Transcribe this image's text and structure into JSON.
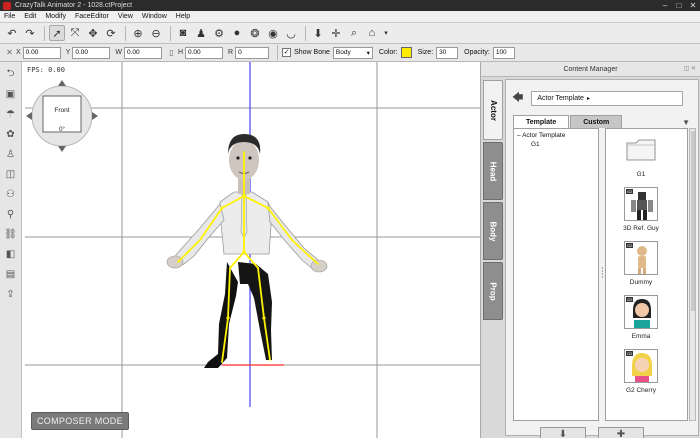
{
  "window": {
    "title": "CrazyTalk Animator 2  -  1028.ctProject"
  },
  "menu": [
    "File",
    "Edit",
    "Modify",
    "FaceEditor",
    "View",
    "Window",
    "Help"
  ],
  "transform": {
    "x_label": "X",
    "x_value": "0.00",
    "y_label": "Y",
    "y_value": "0.00",
    "w_label": "W",
    "w_value": "0.00",
    "h_label": "H",
    "h_value": "0.00",
    "r_label": "R",
    "r_value": "0"
  },
  "bone": {
    "show_bone_label": "Show Bone",
    "show_bone_checked": true,
    "target": "Body",
    "color_label": "Color:",
    "color_value": "#ffeb00",
    "size_label": "Size:",
    "size_value": "30",
    "opacity_label": "Opacity:",
    "opacity_value": "100"
  },
  "viewport": {
    "fps": "FPS: 0.00",
    "camera_view": "Front",
    "camera_angle": "0°",
    "mode_badge": "COMPOSER MODE"
  },
  "content_manager": {
    "title": "Content Manager",
    "side_tabs": [
      "Actor",
      "Head",
      "Body",
      "Prop"
    ],
    "breadcrumb": "Actor Template",
    "tabs": [
      "Template",
      "Custom"
    ],
    "tree": [
      "Actor Template",
      "G1"
    ],
    "thumbnails": [
      {
        "label": "G1",
        "icon": "folder-icon"
      },
      {
        "label": "3D Ref. Guy",
        "icon": "ref-guy-thumbnail"
      },
      {
        "label": "Dummy",
        "icon": "dummy-thumbnail"
      },
      {
        "label": "Emma",
        "icon": "emma-thumbnail"
      },
      {
        "label": "G2 Cherry",
        "icon": "cherry-thumbnail"
      }
    ],
    "bottom_buttons": [
      "down-arrow-icon",
      "plus-icon"
    ]
  }
}
